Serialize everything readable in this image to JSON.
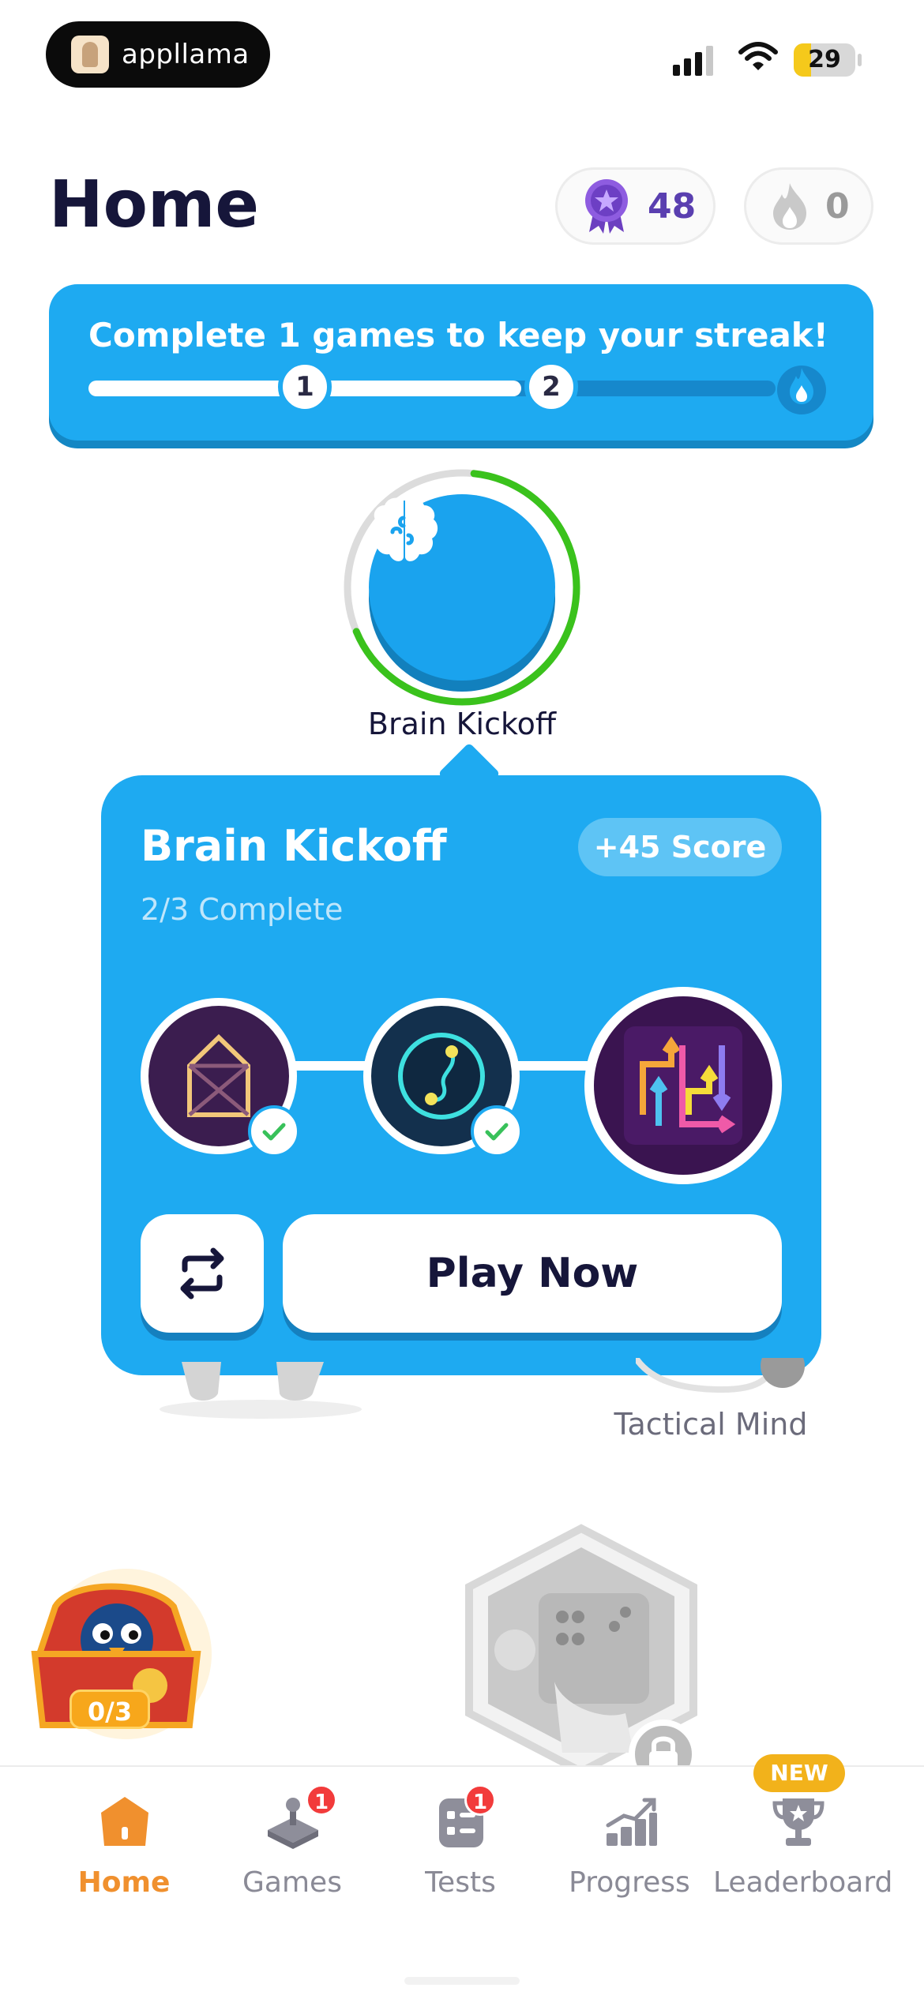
{
  "status_bar": {
    "app_name": "appllama",
    "battery": "29"
  },
  "header": {
    "title": "Home",
    "gems": "48",
    "streak": "0"
  },
  "streak_banner": {
    "text": "Complete 1 games to keep your streak!",
    "milestones": [
      "1",
      "2"
    ],
    "progress": 0.63
  },
  "level": {
    "label": "Brain Kickoff",
    "ring_progress": 0.67
  },
  "popup": {
    "title": "Brain Kickoff",
    "subtitle": "2/3 Complete",
    "score": "+45 Score",
    "play_label": "Play Now",
    "games": [
      {
        "icon": "envelope-game-icon",
        "completed": true
      },
      {
        "icon": "path-game-icon",
        "completed": true
      },
      {
        "icon": "arrows-game-icon",
        "completed": false
      }
    ]
  },
  "map": {
    "tactical_label": "Tactical Mind",
    "chest_count": "0/3"
  },
  "tabs": [
    {
      "label": "Home",
      "icon": "home-icon",
      "active": true
    },
    {
      "label": "Games",
      "icon": "joystick-icon",
      "badge": "1"
    },
    {
      "label": "Tests",
      "icon": "checklist-icon",
      "badge": "1"
    },
    {
      "label": "Progress",
      "icon": "chart-icon"
    },
    {
      "label": "Leaderboard",
      "icon": "trophy-icon",
      "tag": "NEW"
    }
  ],
  "colors": {
    "accent": "#1eaaf1",
    "ring_done": "#3ac21c",
    "tab_active": "#f0902e"
  }
}
